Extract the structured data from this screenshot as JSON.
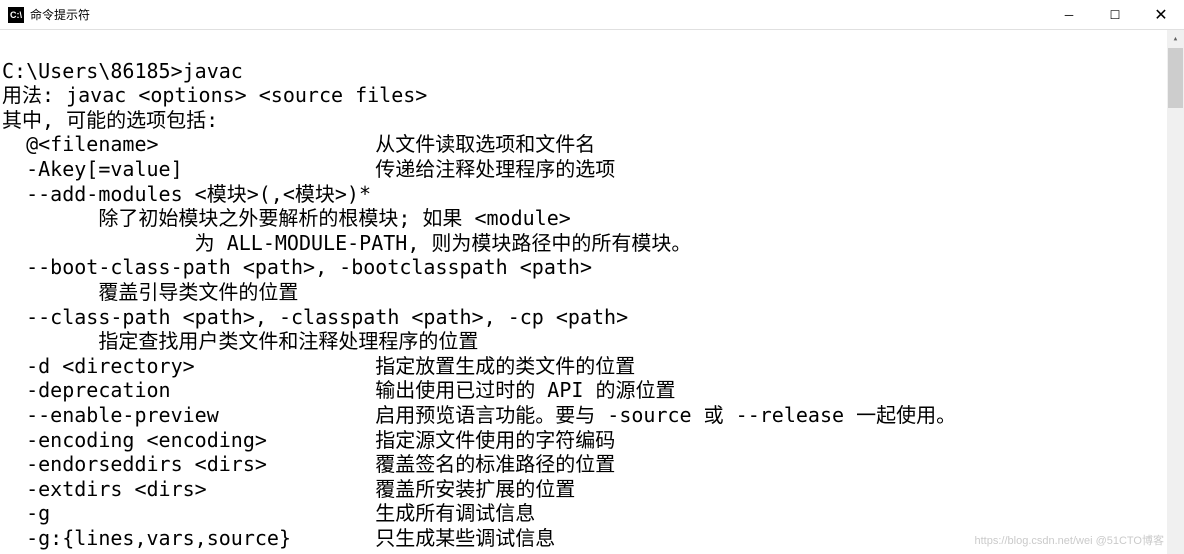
{
  "window": {
    "title": "命令提示符",
    "icon_text": "C:\\"
  },
  "terminal": {
    "lines": [
      "",
      "C:\\Users\\86185>javac",
      "用法: javac <options> <source files>",
      "其中, 可能的选项包括:",
      "  @<filename>                  从文件读取选项和文件名",
      "  -Akey[=value]                传递给注释处理程序的选项",
      "  --add-modules <模块>(,<模块>)*",
      "        除了初始模块之外要解析的根模块; 如果 <module>",
      "                为 ALL-MODULE-PATH, 则为模块路径中的所有模块。",
      "  --boot-class-path <path>, -bootclasspath <path>",
      "        覆盖引导类文件的位置",
      "  --class-path <path>, -classpath <path>, -cp <path>",
      "        指定查找用户类文件和注释处理程序的位置",
      "  -d <directory>               指定放置生成的类文件的位置",
      "  -deprecation                 输出使用已过时的 API 的源位置",
      "  --enable-preview             启用预览语言功能。要与 -source 或 --release 一起使用。",
      "  -encoding <encoding>         指定源文件使用的字符编码",
      "  -endorseddirs <dirs>         覆盖签名的标准路径的位置",
      "  -extdirs <dirs>              覆盖所安装扩展的位置",
      "  -g                           生成所有调试信息",
      "  -g:{lines,vars,source}       只生成某些调试信息"
    ]
  },
  "watermark": "https://blog.csdn.net/wei @51CTO博客"
}
